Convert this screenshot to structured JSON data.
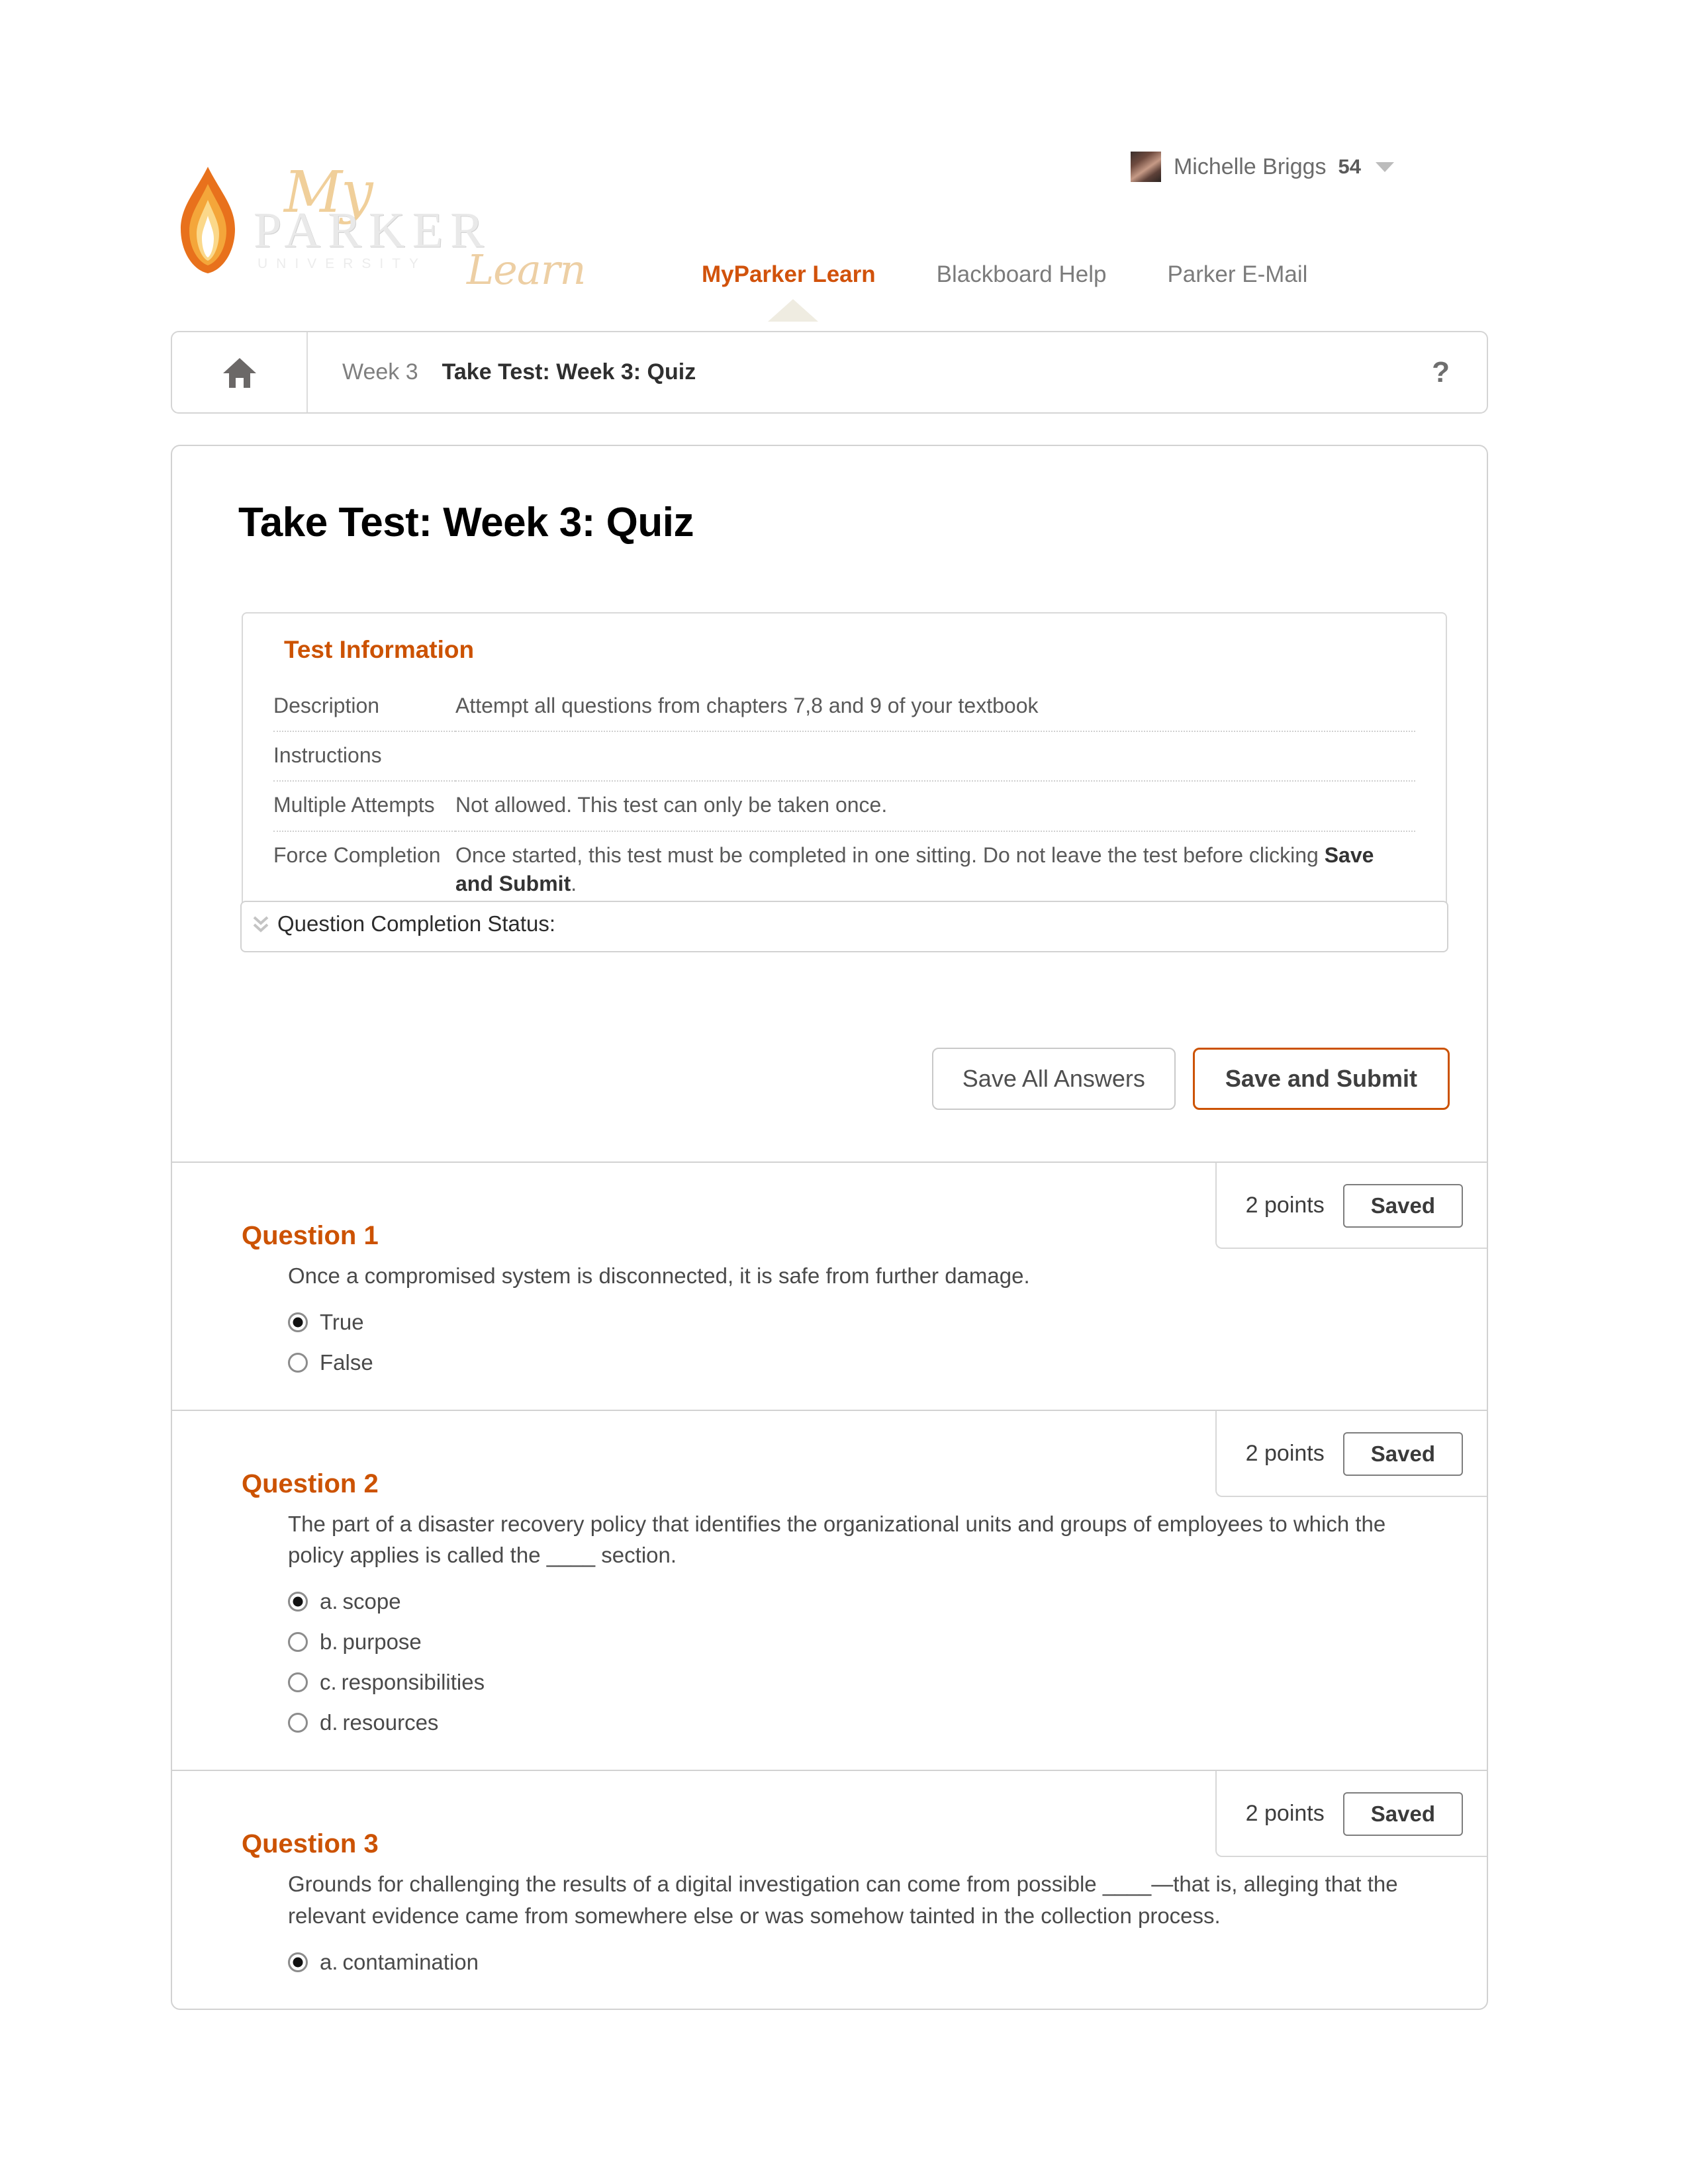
{
  "brand": {
    "logo_my": "My",
    "logo_parker": "PARKER",
    "logo_university": "UNIVERSITY",
    "logo_learn": "Learn",
    "flame_icon": "flame-icon"
  },
  "user": {
    "name": "Michelle Briggs",
    "count": "54",
    "avatar": "user-avatar",
    "caret": "chevron-down-icon"
  },
  "top_nav": {
    "tabs": [
      {
        "label": "MyParker Learn",
        "active": true
      },
      {
        "label": "Blackboard Help",
        "active": false
      },
      {
        "label": "Parker E-Mail",
        "active": false
      }
    ]
  },
  "breadcrumb": {
    "home_icon": "home-icon",
    "items": [
      {
        "label": "Week 3",
        "current": false
      },
      {
        "label": "Take Test: Week 3: Quiz",
        "current": true
      }
    ],
    "help_label": "?"
  },
  "page": {
    "title": "Take Test: Week 3: Quiz"
  },
  "test_information": {
    "title": "Test Information",
    "rows": [
      {
        "label": "Description",
        "value": "Attempt all questions from chapters 7,8 and 9 of your textbook",
        "bold_tail": ""
      },
      {
        "label": "Instructions",
        "value": "",
        "bold_tail": ""
      },
      {
        "label": "Multiple Attempts",
        "value": "Not allowed. This test can only be taken once.",
        "bold_tail": ""
      },
      {
        "label": "Force Completion",
        "value": "Once started, this test must be completed in one sitting. Do not leave the test before clicking ",
        "bold_tail": "Save and Submit",
        "tail_suffix": "."
      }
    ]
  },
  "question_completion_status": {
    "label": "Question Completion Status:",
    "chevron_icon": "double-chevron-down-icon"
  },
  "actions": {
    "save_all_label": "Save All Answers",
    "save_submit_label": "Save and Submit"
  },
  "questions": [
    {
      "heading": "Question 1",
      "points": "2 points",
      "status": "Saved",
      "text": "Once a compromised system is disconnected, it is safe from further damage.",
      "options": [
        {
          "letter": "",
          "text": "True",
          "selected": true
        },
        {
          "letter": "",
          "text": "False",
          "selected": false
        }
      ]
    },
    {
      "heading": "Question 2",
      "points": "2 points",
      "status": "Saved",
      "text": "The part of a disaster recovery policy that identifies the organizational units and groups of employees to which the policy applies is called the ____ section.",
      "options": [
        {
          "letter": "a.",
          "text": "scope",
          "selected": true
        },
        {
          "letter": "b.",
          "text": "purpose",
          "selected": false
        },
        {
          "letter": "c.",
          "text": "responsibilities",
          "selected": false
        },
        {
          "letter": "d.",
          "text": "resources",
          "selected": false
        }
      ]
    },
    {
      "heading": "Question 3",
      "points": "2 points",
      "status": "Saved",
      "text": "Grounds for challenging the results of a digital investigation can come from possible ____—that is, alleging that the relevant evidence came from somewhere else or was somehow tainted in the collection process.",
      "options": [
        {
          "letter": "a.",
          "text": "contamination",
          "selected": true
        }
      ]
    }
  ],
  "colors": {
    "accent_orange": "#cc5200",
    "nav_pointer": "#efece1",
    "border_gray": "#d2d2d2",
    "text_gray": "#4a4a4a"
  }
}
